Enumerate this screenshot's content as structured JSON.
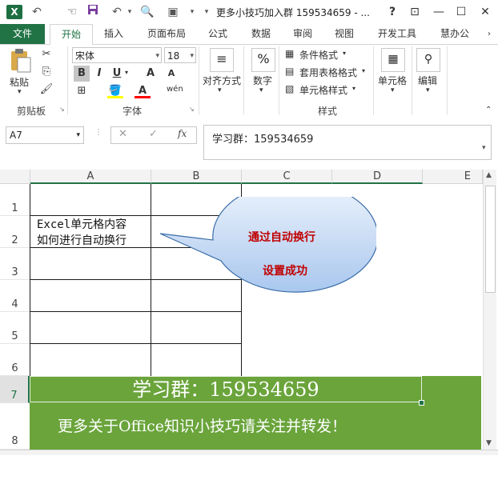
{
  "window": {
    "title": "更多小技巧加入群 159534659 - ...",
    "help": "?",
    "ribbon_display": "⊡",
    "minimize": "—",
    "maximize": "☐",
    "close": "✕"
  },
  "quick_access": {
    "save_icon": "save-icon",
    "undo_icon": "undo-icon"
  },
  "tabs": {
    "file": "文件",
    "items": [
      "开始",
      "插入",
      "页面布局",
      "公式",
      "数据",
      "审阅",
      "视图",
      "开发工具",
      "慧办公"
    ],
    "active": "开始"
  },
  "ribbon": {
    "clipboard": {
      "paste": "粘贴",
      "label": "剪贴板"
    },
    "font": {
      "name": "宋体",
      "size": "18",
      "bold": "B",
      "italic": "I",
      "underline": "U",
      "grow": "A",
      "shrink": "A",
      "font_color": "A",
      "phonetic": "wén",
      "label": "字体"
    },
    "alignment": {
      "label": "对齐方式"
    },
    "number": {
      "label": "数字",
      "symbol": "%"
    },
    "styles": {
      "conditional": "条件格式",
      "table": "套用表格格式",
      "cell_styles": "单元格样式",
      "label": "样式"
    },
    "cells": {
      "label": "单元格"
    },
    "editing": {
      "label": "编辑"
    }
  },
  "formula_bar": {
    "name_box": "A7",
    "cancel": "✕",
    "enter": "✓",
    "fx": "fx",
    "content": "学习群：159534659"
  },
  "sheet": {
    "columns": [
      "A",
      "B",
      "C",
      "D",
      "E"
    ],
    "rows": [
      "1",
      "2",
      "3",
      "4",
      "5",
      "6",
      "7",
      "8"
    ],
    "a2_line1": "Excel单元格内容",
    "a2_line2": "如何进行自动换行",
    "callout_line1": "通过自动换行",
    "callout_line2": "设置成功",
    "band_title": "学习群：159534659",
    "band_subtitle": "更多关于Office知识小技巧请关注并转发！"
  },
  "colors": {
    "excel_green": "#217346",
    "band_green": "#6aa43b",
    "callout_fill": "#c6dcf5",
    "callout_text": "#c00000"
  }
}
